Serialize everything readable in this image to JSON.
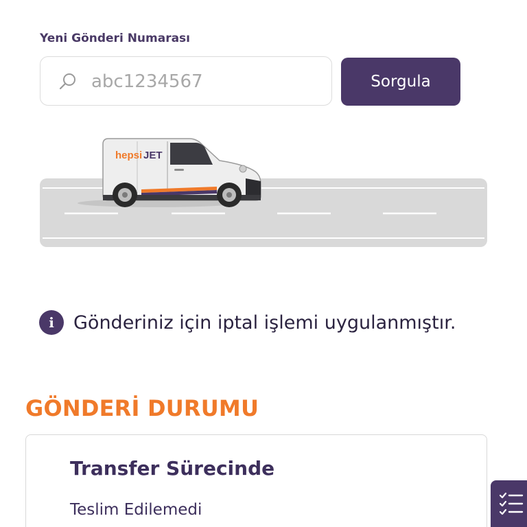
{
  "search": {
    "label": "Yeni Gönderi Numarası",
    "placeholder": "abc1234567",
    "button_label": "Sorgula",
    "icon": "search-icon"
  },
  "vehicle": {
    "brand_left": "hepsi",
    "brand_right": "JET"
  },
  "notice": {
    "icon": "info-icon",
    "icon_glyph": "i",
    "text": "Gönderiniz için iptal işlemi uygulanmıştır."
  },
  "status": {
    "section_title": "GÖNDERİ DURUMU",
    "title": "Transfer Sürecinde",
    "subtitle": "Teslim Edilemedi"
  },
  "floating": {
    "icon": "checklist-icon"
  },
  "colors": {
    "brand_purple": "#4a3868",
    "accent_orange": "#f07a2a",
    "road_gray": "#d9d9d9"
  }
}
